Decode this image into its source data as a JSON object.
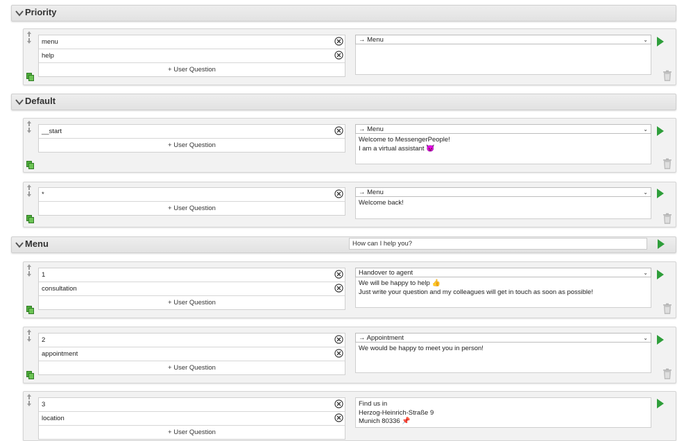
{
  "sections": {
    "priority": {
      "title": "Priority"
    },
    "default": {
      "title": "Default"
    },
    "menu": {
      "title": "Menu",
      "reply": "How can I help you?"
    }
  },
  "add_question_label": "+ User Question",
  "cards": {
    "c1": {
      "questions": [
        "menu",
        "help"
      ],
      "action": "→ Menu",
      "reply_lines": []
    },
    "c2": {
      "questions": [
        "__start"
      ],
      "action": "→ Menu",
      "reply_lines": [
        "Welcome to MessengerPeople!",
        "I am a virtual assistant"
      ],
      "reply_emoji": "😈"
    },
    "c3": {
      "questions": [
        "*"
      ],
      "action": "→ Menu",
      "reply_lines": [
        "Welcome back!"
      ]
    },
    "c4": {
      "questions": [
        "1",
        "consultation"
      ],
      "action": "Handover to agent",
      "reply_lines": [
        "We will be happy to help",
        "Just write your question and my colleagues will get in touch as soon as possible!"
      ],
      "reply_emoji": "👍"
    },
    "c5": {
      "questions": [
        "2",
        "appointment"
      ],
      "action": "→ Appointment",
      "reply_lines": [
        "We would be happy to meet you in person!"
      ]
    },
    "c6": {
      "questions": [
        "3",
        "location"
      ],
      "reply_lines": [
        "Find us in",
        "Herzog-Heinrich-Straße 9",
        "Munich 80336"
      ],
      "reply_emoji": "📌"
    }
  },
  "colors": {
    "play": "#2e9e3a",
    "header_bg": "#e8e8e8"
  },
  "icons": [
    "chevron-down-icon",
    "drag-handle-icon",
    "copy-icon",
    "clear-icon",
    "play-icon",
    "trash-icon",
    "select-caret-icon"
  ]
}
